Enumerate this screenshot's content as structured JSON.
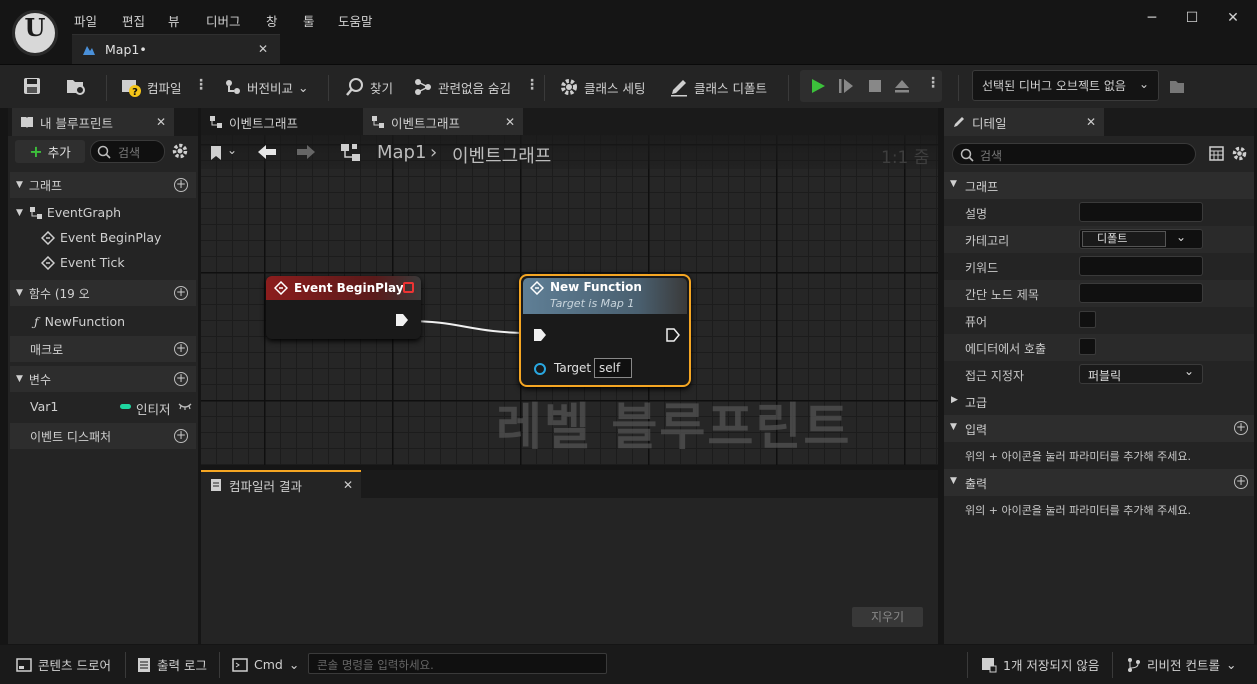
{
  "menu": [
    "파일",
    "편집",
    "뷰",
    "디버그",
    "창",
    "툴",
    "도움말"
  ],
  "map_tab": {
    "label": "Map1•"
  },
  "toolbar": {
    "compile": "컴파일",
    "diff": "버전비교",
    "find": "찾기",
    "hide_unrelated": "관련없음 숨김",
    "class_settings": "클래스 세팅",
    "class_defaults": "클래스 디폴트",
    "debug_object": "선택된 디버그 오브젝트 없음"
  },
  "my_blueprint": {
    "tab": "내 블루프린트",
    "add": "추가",
    "search_placeholder": "검색",
    "graph_category": "그래프",
    "event_graph": "EventGraph",
    "event_begin_play": "Event BeginPlay",
    "event_tick": "Event Tick",
    "functions_category": "함수 (19 오",
    "new_function": "NewFunction",
    "macros_category": "매크로",
    "variables_category": "변수",
    "var1_name": "Var1",
    "var1_type": "인티저",
    "dispatchers_category": "이벤트 디스패처"
  },
  "graph_tabs": [
    "이벤트그래프",
    "이벤트그래프"
  ],
  "graph": {
    "breadcrumb_root": "Map1",
    "breadcrumb_current": "이벤트그래프",
    "zoom": "1:1 줌",
    "watermark": "레벨 블루프린트",
    "node_begin_play": "Event BeginPlay",
    "node_function_title": "New Function",
    "node_function_subtitle": "Target is Map 1",
    "target_label": "Target",
    "target_value": "self"
  },
  "compiler": {
    "tab": "컴파일러 결과",
    "clear": "지우기"
  },
  "details": {
    "tab": "디테일",
    "search_placeholder": "검색",
    "graph_category": "그래프",
    "description": "설명",
    "category": "카테고리",
    "category_value": "디폴트",
    "keywords": "키워드",
    "compact_title": "간단 노드 제목",
    "pure": "퓨어",
    "call_in_editor": "에디터에서 호출",
    "access_specifier": "접근 지정자",
    "access_value": "퍼블릭",
    "advanced": "고급",
    "inputs": "입력",
    "inputs_hint": "위의 + 아이콘을 눌러 파라미터를 추가해 주세요.",
    "outputs": "출력",
    "outputs_hint": "위의 + 아이콘을 눌러 파라미터를 추가해 주세요."
  },
  "statusbar": {
    "content_drawer": "콘텐츠 드로어",
    "output_log": "출력 로그",
    "cmd": "Cmd",
    "console_placeholder": "콘솔 명령을 입력하세요.",
    "unsaved": "1개 저장되지 않음",
    "revision_control": "리비전 컨트롤"
  },
  "colors": {
    "accent_orange": "#f5a623",
    "event_red": "#8c1d1d",
    "function_blue": "#5f7f96",
    "var_green": "#1fd6a0",
    "play_green": "#3cc13b"
  }
}
